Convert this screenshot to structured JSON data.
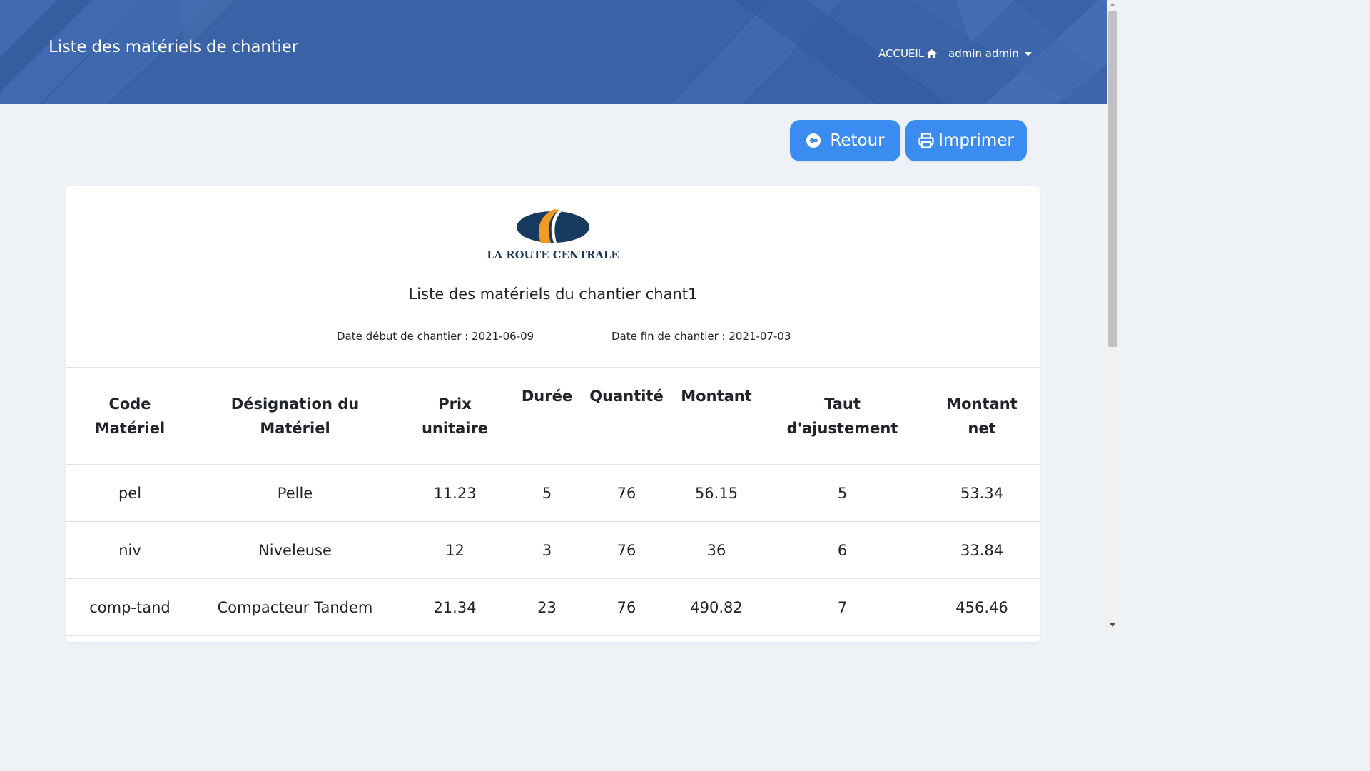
{
  "header": {
    "title": "Liste des matériels de chantier",
    "nav_home": "ACCUEIL",
    "nav_user": "admin admin"
  },
  "actions": {
    "back_label": "Retour",
    "print_label": "Imprimer"
  },
  "report": {
    "logo_text": "LA ROUTE CENTRALE",
    "title": "Liste des matériels du chantier chant1",
    "date_start": "Date début de chantier : 2021-06-09",
    "date_end": "Date fin de chantier : 2021-07-03"
  },
  "table": {
    "columns": [
      [
        "Code",
        "Matériel"
      ],
      [
        "Désignation du",
        "Matériel"
      ],
      [
        "Prix",
        "unitaire"
      ],
      [
        "Durée"
      ],
      [
        "Quantité"
      ],
      [
        "Montant"
      ],
      [
        "Taut",
        "d'ajustement"
      ],
      [
        "Montant",
        "net"
      ]
    ],
    "rows": [
      [
        "pel",
        "Pelle",
        "11.23",
        "5",
        "76",
        "56.15",
        "5",
        "53.34"
      ],
      [
        "niv",
        "Niveleuse",
        "12",
        "3",
        "76",
        "36",
        "6",
        "33.84"
      ],
      [
        "comp-tand",
        "Compacteur Tandem",
        "21.34",
        "23",
        "76",
        "490.82",
        "7",
        "456.46"
      ]
    ]
  },
  "colors": {
    "header_bg": "#3a62a6",
    "button_bg": "#3b8cf0",
    "logo_navy": "#173a5e",
    "logo_orange": "#f39a22"
  },
  "icons": {
    "home": "home-icon",
    "user_menu": "caret-down-icon",
    "back": "arrow-circle-left-icon",
    "print": "printer-icon"
  }
}
